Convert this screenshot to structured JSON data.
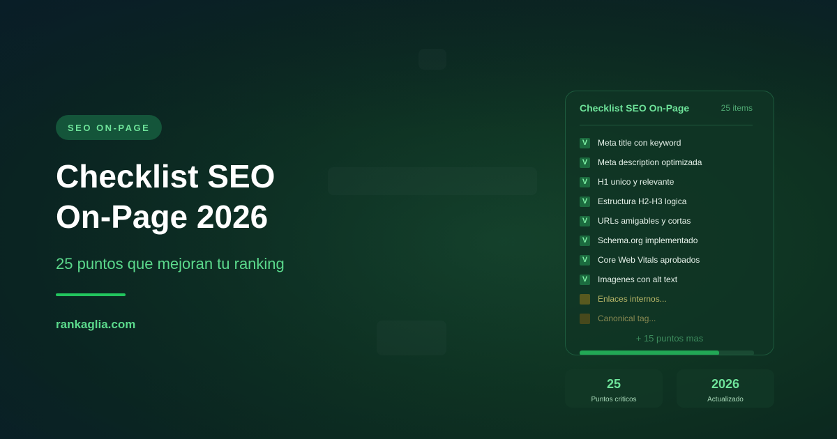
{
  "hero": {
    "badge": "SEO ON-PAGE",
    "title_line1": "Checklist SEO",
    "title_line2": "On-Page 2026",
    "subtitle": "25 puntos que mejoran tu ranking",
    "domain": "rankaglia.com"
  },
  "checklist": {
    "title": "Checklist SEO On-Page",
    "count": "25 items",
    "items": [
      {
        "mark": "V",
        "label": "Meta title con keyword",
        "status": "done"
      },
      {
        "mark": "V",
        "label": "Meta description optimizada",
        "status": "done"
      },
      {
        "mark": "V",
        "label": "H1 unico y relevante",
        "status": "done"
      },
      {
        "mark": "V",
        "label": "Estructura H2-H3 logica",
        "status": "done"
      },
      {
        "mark": "V",
        "label": "URLs amigables y cortas",
        "status": "done"
      },
      {
        "mark": "V",
        "label": "Schema.org implementado",
        "status": "done"
      },
      {
        "mark": "V",
        "label": "Core Web Vitals aprobados",
        "status": "done"
      },
      {
        "mark": "V",
        "label": "Imagenes con alt text",
        "status": "done"
      },
      {
        "mark": "",
        "label": "Enlaces internos...",
        "status": "pending"
      },
      {
        "mark": "",
        "label": "Canonical tag...",
        "status": "pending"
      }
    ],
    "more": "+ 15 puntos mas",
    "progress": 0.8
  },
  "stats": [
    {
      "value": "25",
      "label": "Puntos criticos"
    },
    {
      "value": "2026",
      "label": "Actualizado"
    }
  ],
  "colors": {
    "accent": "#22c55e",
    "accent_text": "#5bd98c",
    "pending": "#58591f"
  }
}
